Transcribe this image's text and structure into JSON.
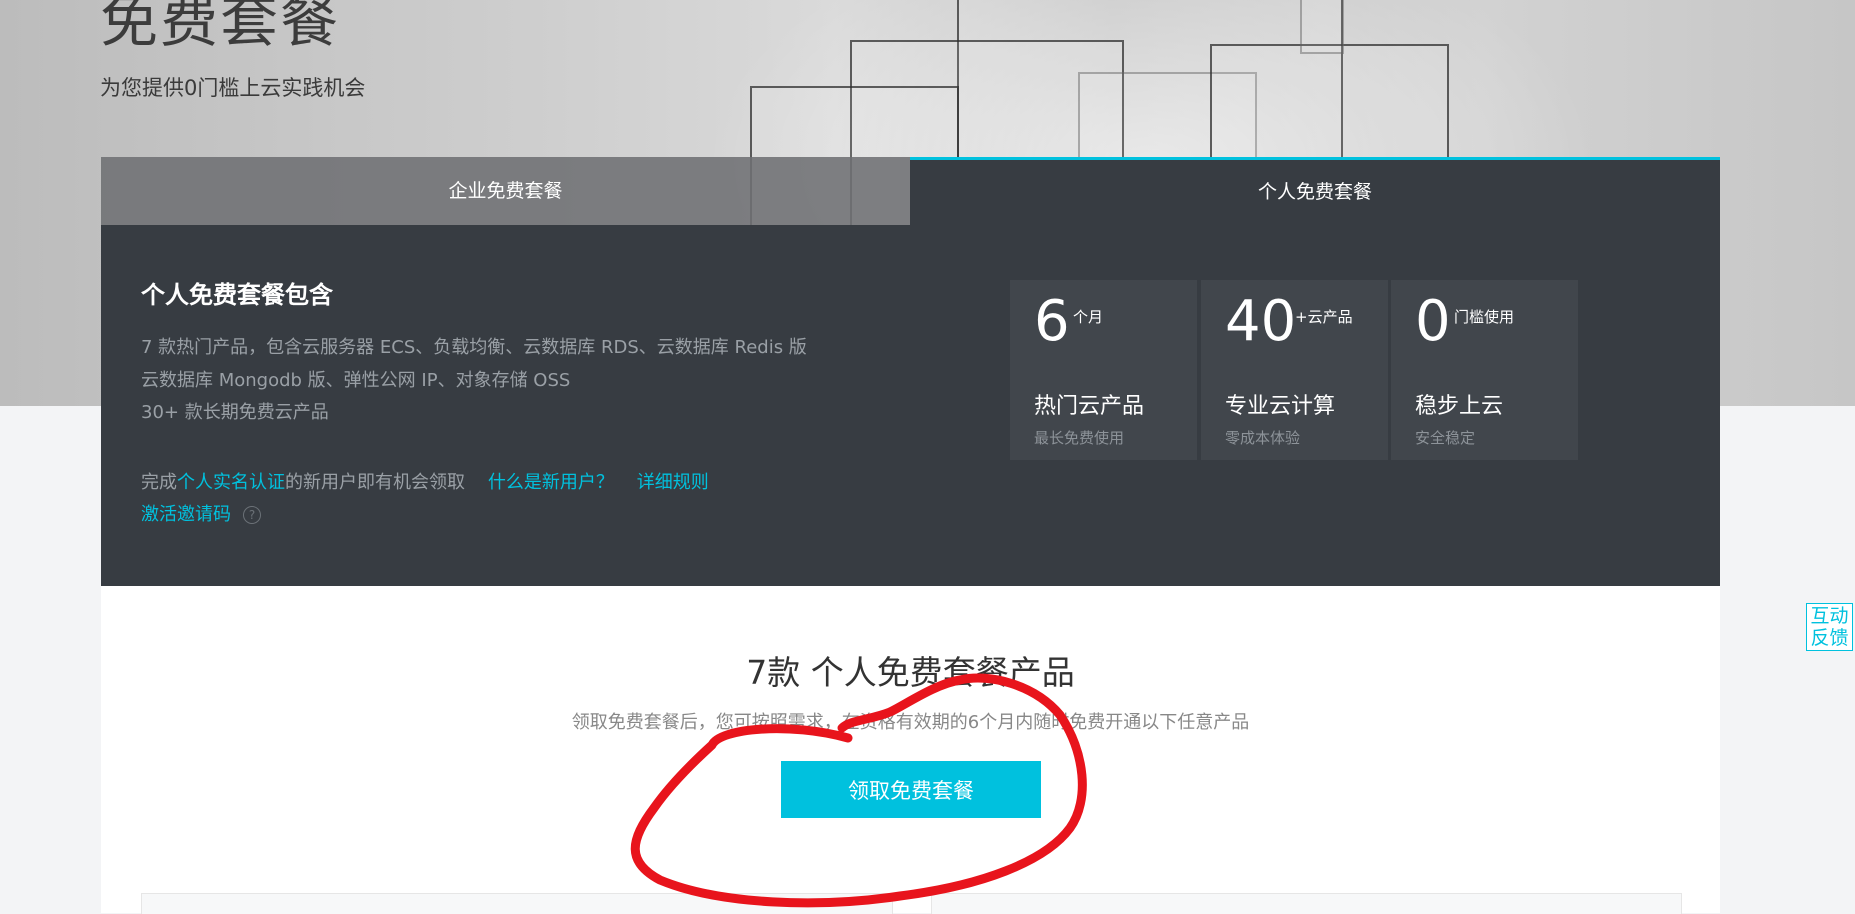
{
  "hero": {
    "title": "免费套餐",
    "subtitle": "为您提供0门槛上云实践机会"
  },
  "tabs": [
    {
      "label": "企业免费套餐",
      "active": false
    },
    {
      "label": "个人免费套餐",
      "active": true
    }
  ],
  "panel": {
    "heading": "个人免费套餐包含",
    "description_lines": [
      "7 款热门产品，包含云服务器 ECS、负载均衡、云数据库 RDS、云数据库 Redis 版",
      "云数据库 Mongodb 版、弹性公网 IP、对象存储 OSS",
      "30+ 款长期免费云产品"
    ],
    "eligibility": {
      "prefix": "完成",
      "auth_link": "个人实名认证",
      "suffix": "的新用户即有机会领取",
      "new_user_link": "什么是新用户？",
      "rules_link": "详细规则"
    },
    "invite_link": "激活邀请码",
    "help_icon": "?",
    "stats": [
      {
        "number": "6",
        "unit": "个月",
        "title": "热门云产品",
        "subtitle": "最长免费使用"
      },
      {
        "number": "40",
        "unit": "+云产品",
        "title": "专业云计算",
        "subtitle": "零成本体验"
      },
      {
        "number": "0",
        "unit": "门槛使用",
        "title": "稳步上云",
        "subtitle": "安全稳定"
      }
    ]
  },
  "content": {
    "title": "7款 个人免费套餐产品",
    "description": "领取免费套餐后，您可按照需求，在资格有效期的6个月内随时免费开通以下任意产品",
    "claim_button": "领取免费套餐"
  },
  "feedback": {
    "line1": "互动",
    "line2": "反馈"
  },
  "colors": {
    "accent": "#00c1de",
    "panel_bg": "#373c42",
    "card_bg": "#41464c",
    "annotation": "#e8141c"
  }
}
